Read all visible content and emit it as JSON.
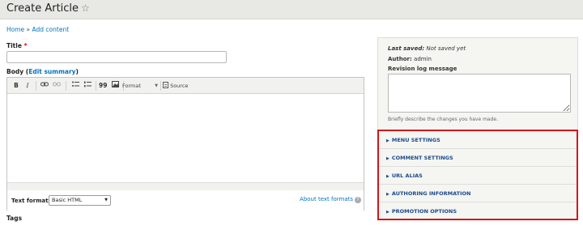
{
  "page_title": "Create Article",
  "breadcrumb": {
    "home": "Home",
    "separator": "»",
    "current": "Add content"
  },
  "title_field": {
    "label": "Title",
    "required_mark": "*",
    "value": ""
  },
  "body_field": {
    "label": "Body",
    "edit_summary_link": "Edit summary",
    "open_paren": "(",
    "close_paren": ")"
  },
  "toolbar": {
    "bold": "B",
    "italic": "I",
    "link": "link-icon",
    "unlink": "unlink-icon",
    "bullet_list": "bullet-list-icon",
    "numbered_list": "numbered-list-icon",
    "blockquote": "99",
    "image": "image-icon",
    "format_label": "Format",
    "source_label": "Source"
  },
  "text_format": {
    "label": "Text format",
    "selected": "Basic HTML",
    "help_link": "About text formats",
    "help_icon": "?"
  },
  "tags_label": "Tags",
  "sidebar": {
    "last_saved_label": "Last saved:",
    "last_saved_value": "Not saved yet",
    "author_label": "Author:",
    "author_value": "admin",
    "revision_label": "Revision log message",
    "revision_value": "",
    "revision_hint": "Briefly describe the changes you have made."
  },
  "collapsible_sections": [
    {
      "label": "MENU SETTINGS"
    },
    {
      "label": "COMMENT SETTINGS"
    },
    {
      "label": "URL ALIAS"
    },
    {
      "label": "AUTHORING INFORMATION"
    },
    {
      "label": "PROMOTION OPTIONS"
    }
  ],
  "colors": {
    "link": "#0074bd",
    "highlight_border": "#d0161b",
    "section_text": "#1a4b8c"
  }
}
